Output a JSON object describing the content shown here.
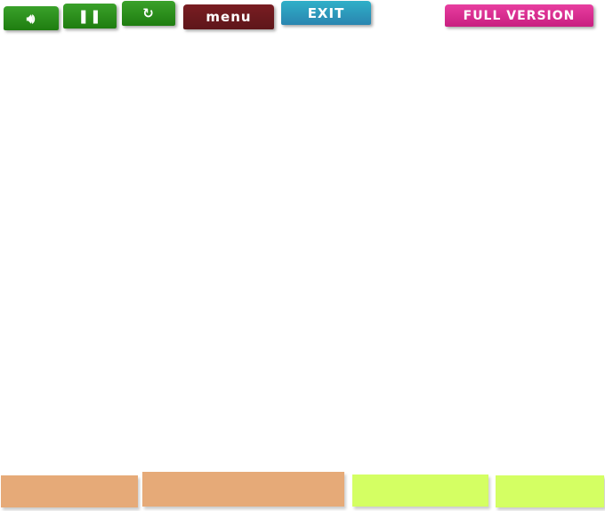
{
  "toolbar": {
    "sound_icon": "speaker-icon",
    "pause_icon": "pause-icon",
    "restart_icon": "refresh-icon",
    "menu_label": "menu",
    "exit_label": "exit",
    "full_version_label": "FULL VERSION"
  },
  "colors": {
    "green": "#2a8e1c",
    "menu": "#6b1a1e",
    "exit": "#2a9fc0",
    "full_version": "#d62d91",
    "orange_panel": "#e6aa78",
    "lime_panel": "#d4ff63"
  }
}
